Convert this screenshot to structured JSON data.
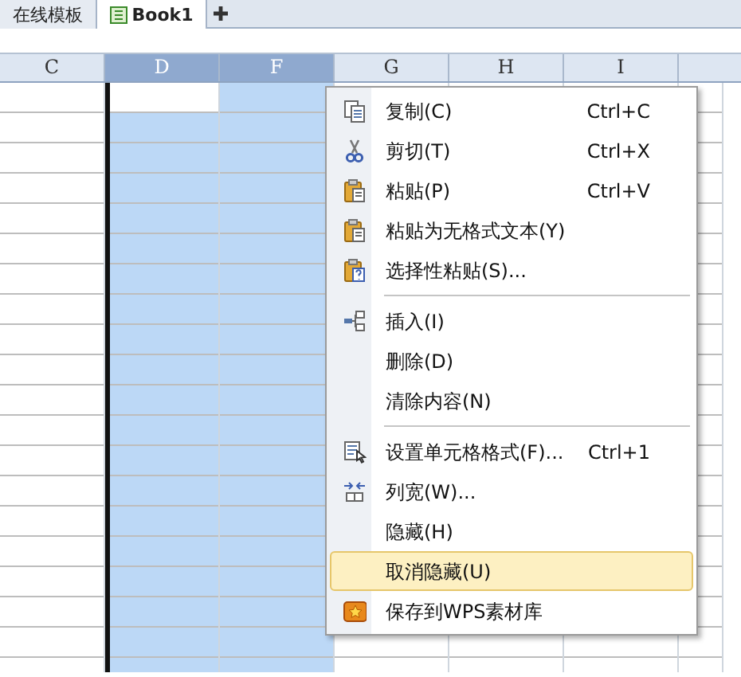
{
  "tabs": [
    {
      "label": "在线模板",
      "selected": false
    },
    {
      "label": "Book1",
      "selected": true
    }
  ],
  "columns": [
    {
      "label": "C",
      "selected": false,
      "active": false
    },
    {
      "label": "D",
      "selected": true,
      "active": true
    },
    {
      "label": "F",
      "selected": true,
      "active": false
    },
    {
      "label": "G",
      "selected": false,
      "active": false
    },
    {
      "label": "H",
      "selected": false,
      "active": false
    },
    {
      "label": "I",
      "selected": false,
      "active": false
    }
  ],
  "context_menu": {
    "items": [
      {
        "kind": "item",
        "label": "复制(C)",
        "shortcut": "Ctrl+C",
        "selected": false
      },
      {
        "kind": "item",
        "label": "剪切(T)",
        "shortcut": "Ctrl+X",
        "selected": false
      },
      {
        "kind": "item",
        "label": "粘贴(P)",
        "shortcut": "Ctrl+V",
        "selected": false
      },
      {
        "kind": "item",
        "label": "粘贴为无格式文本(Y)",
        "selected": false
      },
      {
        "kind": "item",
        "label": "选择性粘贴(S)...",
        "selected": false
      },
      {
        "kind": "separator"
      },
      {
        "kind": "item",
        "label": "插入(I)",
        "selected": false
      },
      {
        "kind": "item",
        "label": "删除(D)",
        "selected": false
      },
      {
        "kind": "item",
        "label": "清除内容(N)",
        "selected": false
      },
      {
        "kind": "separator"
      },
      {
        "kind": "item",
        "label": "设置单元格格式(F)...",
        "shortcut": "Ctrl+1",
        "selected": false
      },
      {
        "kind": "item",
        "label": "列宽(W)...",
        "selected": false
      },
      {
        "kind": "item",
        "label": "隐藏(H)",
        "selected": false
      },
      {
        "kind": "item",
        "label": "取消隐藏(U)",
        "selected": true
      },
      {
        "kind": "item",
        "label": "保存到WPS素材库",
        "selected": false
      }
    ]
  }
}
